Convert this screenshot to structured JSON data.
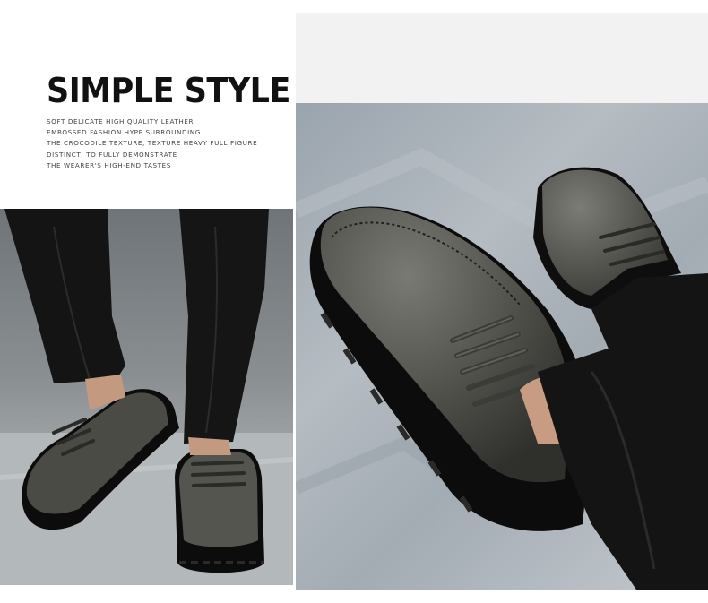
{
  "headline": {
    "title": "SIMPLE STYLE",
    "lines": [
      "SOFT DELICATE HIGH QUALITY LEATHER",
      "EMBOSSED FASHION HYPE SURROUNDING",
      "THE CROCODILE TEXTURE, TEXTURE HEAVY FULL FIGURE",
      "DISTINCT, TO FULLY DEMONSTRATE",
      "THE WEARER'S HIGH-END TASTES"
    ]
  },
  "colors": {
    "leather": "#4a4a46",
    "sole": "#111111",
    "trouser": "#141414",
    "floor": "#a9b1b8"
  }
}
